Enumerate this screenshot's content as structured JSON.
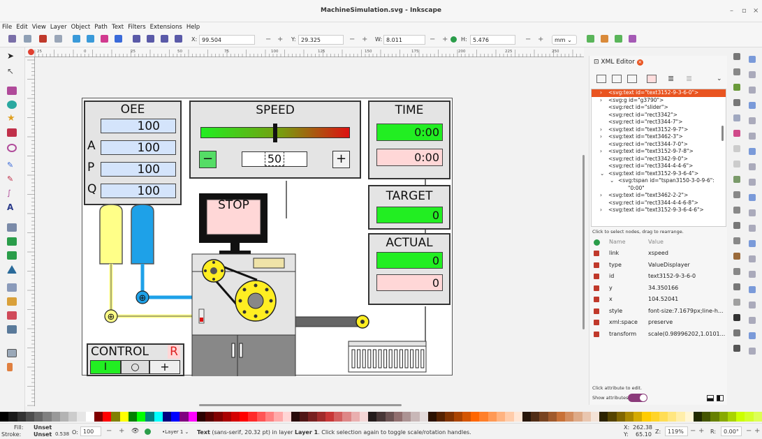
{
  "window": {
    "title": "MachineSimulation.svg - Inkscape",
    "minimize": "–",
    "restore": "▫",
    "close": "×"
  },
  "menu": [
    "File",
    "Edit",
    "View",
    "Layer",
    "Object",
    "Path",
    "Text",
    "Filters",
    "Extensions",
    "Help"
  ],
  "toolbar": {
    "x_label": "X:",
    "x_value": "99.504",
    "y_label": "Y:",
    "y_value": "29.325",
    "w_label": "W:",
    "w_value": "8.011",
    "h_label": "H:",
    "h_value": "5.476",
    "unit": "mm",
    "minus": "−",
    "plus": "+"
  },
  "ruler": {
    "h_ticks": [
      "25",
      "0",
      "25",
      "50",
      "75",
      "100",
      "125",
      "150",
      "175",
      "200",
      "225",
      "250"
    ]
  },
  "canvas": {
    "oee": {
      "title": "OEE",
      "value": "100",
      "a_label": "A",
      "a_value": "100",
      "p_label": "P",
      "p_value": "100",
      "q_label": "Q",
      "q_value": "100"
    },
    "speed": {
      "title": "SPEED",
      "value": "50",
      "minus": "−",
      "plus": "+"
    },
    "time": {
      "title": "TIME",
      "value1": "0:00",
      "value2": "0:00"
    },
    "target": {
      "title": "TARGET",
      "value": "0"
    },
    "actual": {
      "title": "ACTUAL",
      "value1": "0",
      "value2": "0"
    },
    "stop": "STOP",
    "control": {
      "title": "CONTROL",
      "r": "R",
      "btn1": "I",
      "btn2": "○",
      "btn3": "+"
    }
  },
  "xml_editor": {
    "tab_title": "XML Editor",
    "nodes": [
      {
        "text": "<svg:text id=\"text3152-9-3-6-0\">",
        "arrow": "›",
        "selected": true
      },
      {
        "text": "<svg:g id=\"g3790\">",
        "arrow": "›"
      },
      {
        "text": "<svg:rect id=\"slider\">",
        "arrow": ""
      },
      {
        "text": "<svg:rect id=\"rect3342\">",
        "arrow": ""
      },
      {
        "text": "<svg:rect id=\"rect3344-7\">",
        "arrow": ""
      },
      {
        "text": "<svg:text id=\"text3152-9-7\">",
        "arrow": "›"
      },
      {
        "text": "<svg:text id=\"text3462-3\">",
        "arrow": "›"
      },
      {
        "text": "<svg:rect id=\"rect3344-7-0\">",
        "arrow": ""
      },
      {
        "text": "<svg:text id=\"text3152-9-7-8\">",
        "arrow": "›"
      },
      {
        "text": "<svg:rect id=\"rect3342-9-0\">",
        "arrow": ""
      },
      {
        "text": "<svg:rect id=\"rect3344-4-4-6\">",
        "arrow": ""
      },
      {
        "text": "<svg:text id=\"text3152-9-3-6-4\">",
        "arrow": "⌄"
      },
      {
        "text": "<svg:tspan id=\"tspan3150-3-0-9-6\":",
        "arrow": "⌄",
        "indent": true
      },
      {
        "text": "\"0:00\"",
        "arrow": "",
        "indent2": true
      },
      {
        "text": "<svg:text id=\"text3462-2-2\">",
        "arrow": "›"
      },
      {
        "text": "<svg:rect id=\"rect3344-4-4-6-8\">",
        "arrow": ""
      },
      {
        "text": "<svg:text id=\"text3152-9-3-6-4-6\">",
        "arrow": "›"
      }
    ],
    "hint": "Click to select nodes, drag to rearrange.",
    "attr_header": {
      "name": "Name",
      "value": "Value"
    },
    "attributes": [
      {
        "name": "link",
        "value": "xspeed"
      },
      {
        "name": "type",
        "value": "ValueDisplayer"
      },
      {
        "name": "id",
        "value": "text3152-9-3-6-0"
      },
      {
        "name": "y",
        "value": "34.350166"
      },
      {
        "name": "x",
        "value": "104.52041"
      },
      {
        "name": "style",
        "value": "font-size:7.1679px;line-h..."
      },
      {
        "name": "xml:space",
        "value": "preserve"
      },
      {
        "name": "transform",
        "value": "scale(0.98996202,1.0101..."
      }
    ],
    "edit_hint": "Click attribute to edit.",
    "show_attributes": "Show attributes"
  },
  "status": {
    "fill_label": "Fill:",
    "fill_value": "Unset",
    "stroke_label": "Stroke:",
    "stroke_value": "Unset",
    "stroke_width": "0.538",
    "opacity_label": "O:",
    "opacity_value": "100",
    "layer": "•Layer 1",
    "message_bold": "Text",
    "message": " (sans-serif, 20.32 pt) in layer ",
    "message_layer": "Layer 1",
    "message_end": ". Click selection again to toggle scale/rotation handles.",
    "x_label": "X:",
    "x_value": "262.38",
    "y_label": "Y:",
    "y_value": "65.10",
    "zoom_label": "Z:",
    "zoom_value": "119%",
    "rot_label": "R:",
    "rot_value": "0.00°"
  },
  "colors": {
    "accent": "#e95420",
    "green": "#22ee22",
    "pink": "#ffd7d7",
    "blue": "#d4e4fb",
    "yellow": "#ffee22",
    "cyan": "#1ea1e8"
  }
}
